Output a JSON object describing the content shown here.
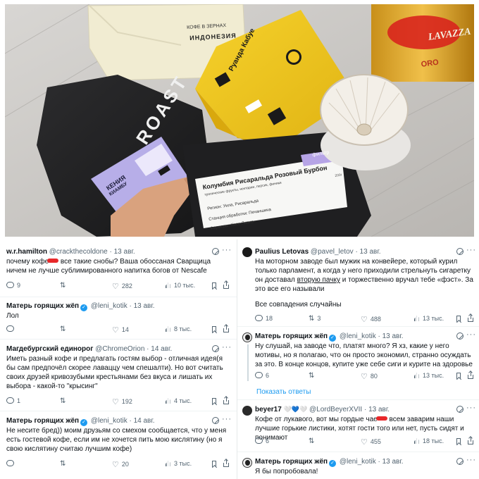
{
  "photo": {
    "white_bag": {
      "line1": "КОФЕ В ЗЕРНАХ",
      "line2": "ИНДОНЕЗИЯ"
    },
    "yellow_bag": {
      "label": "Руанда Кабуе"
    },
    "black_bag": {
      "brand": "ROAST",
      "card_title": "КЕНИЯ",
      "card_sub": "КИАМБУ"
    },
    "filter_card": {
      "tag": "фильтр",
      "title": "Колумбия Рисаральда Розовый Бурбон",
      "descriptors": "тропические фрукты, нектарин, персик, финики",
      "region": "Регион: Уила, Рисаральда",
      "processing": "Станция обработки: Печаншина",
      "farmers": "Фермеры: Хосе Ливио",
      "weight": "200г"
    },
    "tin": {
      "brand": "LAVAZZA",
      "label": "ORO"
    }
  },
  "tweets_left": [
    {
      "name": "w.r.hamilton",
      "handle": "@crackthecoldone",
      "date": "· 13 авг.",
      "text_a": "почему кофе",
      "text_b": " все такие снобы? Ваша обоссаная Сварщица ничем не лучше сублимированного напитка богов от Nescafe",
      "reply": "9",
      "retweet": "",
      "like": "282",
      "views": "10 тыс."
    },
    {
      "name": "Матерь горящих жёп",
      "verified_glyph": "✓",
      "handle": "@leni_kotik",
      "date": "· 13 авг.",
      "text": "Лол",
      "reply": "",
      "retweet": "",
      "like": "14",
      "views": "8 тыс."
    },
    {
      "name": "Магдебургский единорог",
      "handle": "@ChromeOrion",
      "date": "· 14 авг.",
      "text": "Иметь разный кофе и предлагать гостям выбор - отличная идея(я бы сам предпочёл скорее лаваццу чем спешалти). Но вот считать своих друзей кривозубыми крестьянами без вкуса и лишать их выбора - какой-то \"крысинг\"",
      "reply": "1",
      "retweet": "",
      "like": "192",
      "views": "4 тыс."
    },
    {
      "name": "Матерь горящих жёп",
      "verified_glyph": "✓",
      "handle": "@leni_kotik",
      "date": "· 14 авг.",
      "text": "Не несите бред)) моим друзьям со смехом сообщается, что у меня есть гостевой кофе, если им не хочется пить мою кислятину (но я свою кислятину считаю лучшим кофе)",
      "reply": "",
      "retweet": "",
      "like": "20",
      "views": "3 тыс."
    }
  ],
  "tweets_right": [
    {
      "name": "Paulius Letovas",
      "handle": "@pavel_letov",
      "date": "· 13 авг.",
      "text_a": "На моторном заводе был мужик на конвейере, который курил только парламент, а когда у него приходили стрельнуть сигаретку он доставал ",
      "text_ul": "вторую пачку",
      "text_b": " и торжественно вручал тебе «фэст». За это все его называли",
      "text_c": "Все совпадения случайны",
      "reply": "18",
      "retweet": "3",
      "like": "488",
      "views": "13 тыс."
    },
    {
      "name": "Матерь горящих жёп",
      "verified_glyph": "✓",
      "handle": "@leni_kotik",
      "date": "· 13 авг.",
      "text": "Ну слушай, на заводе что, платят много? Я хз, какие у него мотивы, но я полагаю, что он просто экономил, странно осуждать за это. В конце концов, купите уже себе сиги и курите на здоровье",
      "reply": "6",
      "retweet": "",
      "like": "80",
      "views": "13 тыс.",
      "show_replies": "Показать ответы"
    },
    {
      "name": "beyer17",
      "hearts": "🤍💙🤍",
      "handle": "@LordBeyerXVII",
      "date": "· 13 авг.",
      "text_a": "Кофе от лукавого, вот мы гордые чае",
      "text_b": " всем заварим наши лучшие горькие листики, хотят гости того или нет, пусть сидят и понимают",
      "reply": "6",
      "retweet": "",
      "like": "455",
      "views": "18 тыс."
    },
    {
      "name": "Матерь горящих жёп",
      "verified_glyph": "✓",
      "handle": "@leni_kotik",
      "date": "· 13 авг.",
      "text": "Я бы попробовала!"
    }
  ],
  "icons": {
    "reply": "reply-icon",
    "retweet_glyph": "⇅",
    "like_glyph": "♡",
    "views": "views-icon",
    "more_glyph": "···",
    "bookmark": "bookmark-icon",
    "share": "share-icon"
  },
  "colors": {
    "link": "#1d9bf0",
    "muted": "#536471",
    "redact": "#e8282a",
    "text": "#0f1419"
  }
}
